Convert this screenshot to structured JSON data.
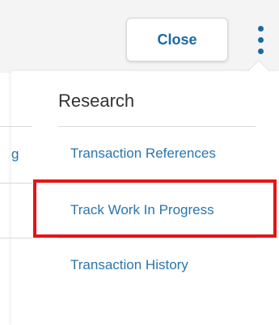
{
  "header": {
    "close_label": "Close",
    "more_icon": "kebab-vertical-icon"
  },
  "background_nav": {
    "truncated_text": "g"
  },
  "menu": {
    "section_title": "Research",
    "items": [
      {
        "label": "Transaction References"
      },
      {
        "label": "Track Work In Progress"
      },
      {
        "label": "Transaction History"
      }
    ]
  },
  "highlight_color": "#e61414",
  "accent_color": "#1a6aa2"
}
